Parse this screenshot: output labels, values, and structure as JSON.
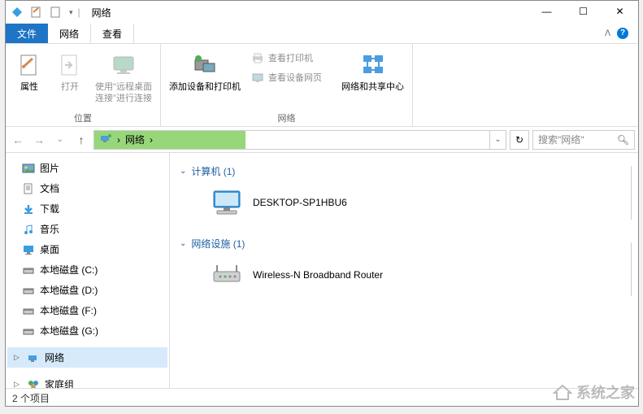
{
  "title": "网络",
  "win_controls": {
    "min": "—",
    "max": "☐",
    "close": "✕"
  },
  "tabs": {
    "file": "文件",
    "network": "网络",
    "view": "查看"
  },
  "ribbon": {
    "group1_label": "位置",
    "props": "属性",
    "open": "打开",
    "remote_desktop": "使用\"远程桌面连接\"进行连接",
    "group2_label": "网络",
    "add_devices": "添加设备和打印机",
    "view_printers": "查看打印机",
    "view_device_page": "查看设备网页",
    "network_sharing": "网络和共享中心"
  },
  "nav": {
    "breadcrumb_root": "网络",
    "sep": "›",
    "search_placeholder": "搜索\"网络\""
  },
  "tree": {
    "pictures": "图片",
    "documents": "文档",
    "downloads": "下载",
    "music": "音乐",
    "desktop": "桌面",
    "disk_c": "本地磁盘 (C:)",
    "disk_d": "本地磁盘 (D:)",
    "disk_f": "本地磁盘 (F:)",
    "disk_g": "本地磁盘 (G:)",
    "network": "网络",
    "homegroup": "家庭组"
  },
  "main": {
    "computers_header": "计算机 (1)",
    "computer_name": "DESKTOP-SP1HBU6",
    "infra_header": "网络设施 (1)",
    "router_name": "Wireless-N Broadband Router"
  },
  "status": {
    "item_count": "2 个项目"
  },
  "watermark": "系统之家"
}
